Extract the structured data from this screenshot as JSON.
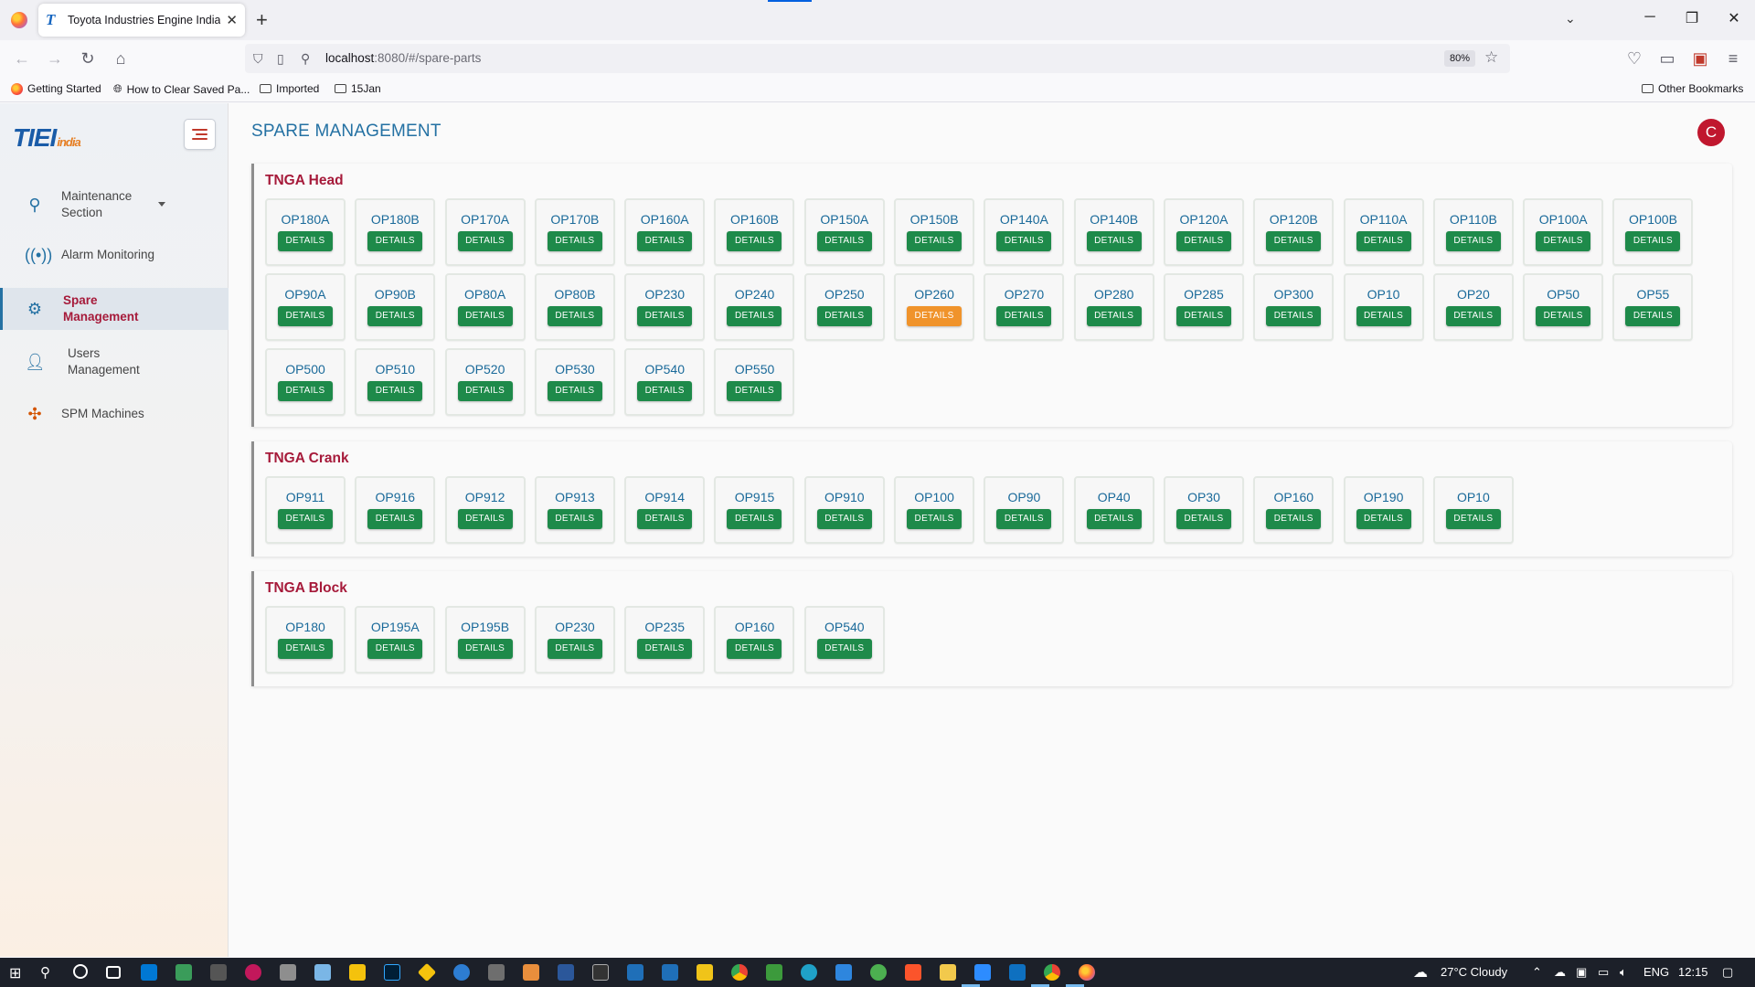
{
  "browser": {
    "tab_title": "Toyota Industries Engine India",
    "url_host": "localhost",
    "url_rest": ":8080/#/spare-parts",
    "zoom": "80%",
    "bookmarks": [
      "Getting Started",
      "How to Clear Saved Pa...",
      "Imported",
      "15Jan"
    ],
    "other_bookmarks": "Other Bookmarks"
  },
  "app": {
    "logo_main": "TIEI",
    "logo_sub": "india",
    "page_title": "SPARE MANAGEMENT",
    "avatar_initial": "C",
    "sidebar": [
      {
        "line1": "Maintenance",
        "line2": "Section",
        "icon": "search-icon",
        "active": false
      },
      {
        "line1": "Alarm Monitoring",
        "line2": "",
        "icon": "alarm-icon",
        "active": false
      },
      {
        "line1": "Spare",
        "line2": "Management",
        "icon": "gear-icon",
        "active": true
      },
      {
        "line1": "Users",
        "line2": "Management",
        "icon": "user-icon",
        "active": false
      },
      {
        "line1": "SPM Machines",
        "line2": "",
        "icon": "machine-icon",
        "active": false
      }
    ],
    "details_label": "DETAILS",
    "sections": [
      {
        "title": "TNGA Head",
        "ops": [
          "OP180A",
          "OP180B",
          "OP170A",
          "OP170B",
          "OP160A",
          "OP160B",
          "OP150A",
          "OP150B",
          "OP140A",
          "OP140B",
          "OP120A",
          "OP120B",
          "OP110A",
          "OP110B",
          "OP100A",
          "OP100B",
          "OP90A",
          "OP90B",
          "OP80A",
          "OP80B",
          "OP230",
          "OP240",
          "OP250",
          "OP260",
          "OP270",
          "OP280",
          "OP285",
          "OP300",
          "OP10",
          "OP20",
          "OP50",
          "OP55",
          "OP500",
          "OP510",
          "OP520",
          "OP530",
          "OP540",
          "OP550"
        ],
        "highlighted": "OP260"
      },
      {
        "title": "TNGA Crank",
        "ops": [
          "OP911",
          "OP916",
          "OP912",
          "OP913",
          "OP914",
          "OP915",
          "OP910",
          "OP100",
          "OP90",
          "OP40",
          "OP30",
          "OP160",
          "OP190",
          "OP10"
        ],
        "highlighted": ""
      },
      {
        "title": "TNGA Block",
        "ops": [
          "OP180",
          "OP195A",
          "OP195B",
          "OP230",
          "OP235",
          "OP160",
          "OP540"
        ],
        "highlighted": ""
      }
    ]
  },
  "taskbar": {
    "weather": "27°C  Cloudy",
    "lang": "ENG",
    "time": "12:15"
  },
  "colors": {
    "accent_blue": "#2471a3",
    "section_title": "#a61a3a",
    "details_green": "#1e8a4a",
    "details_warn": "#f0932b"
  }
}
